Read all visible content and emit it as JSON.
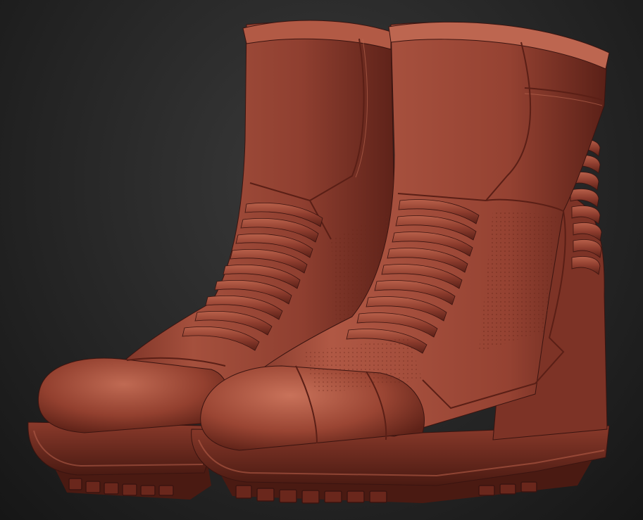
{
  "scene": {
    "subject": "boot-pair-sculpt",
    "colors": {
      "background_center": "#3a3a3a",
      "background_edge": "#161616",
      "clay_base": "#8b3a2c",
      "clay_light": "#b65a45",
      "clay_mid": "#9c4332",
      "clay_dark": "#5a1f16",
      "clay_shadow": "#3a1410"
    }
  }
}
